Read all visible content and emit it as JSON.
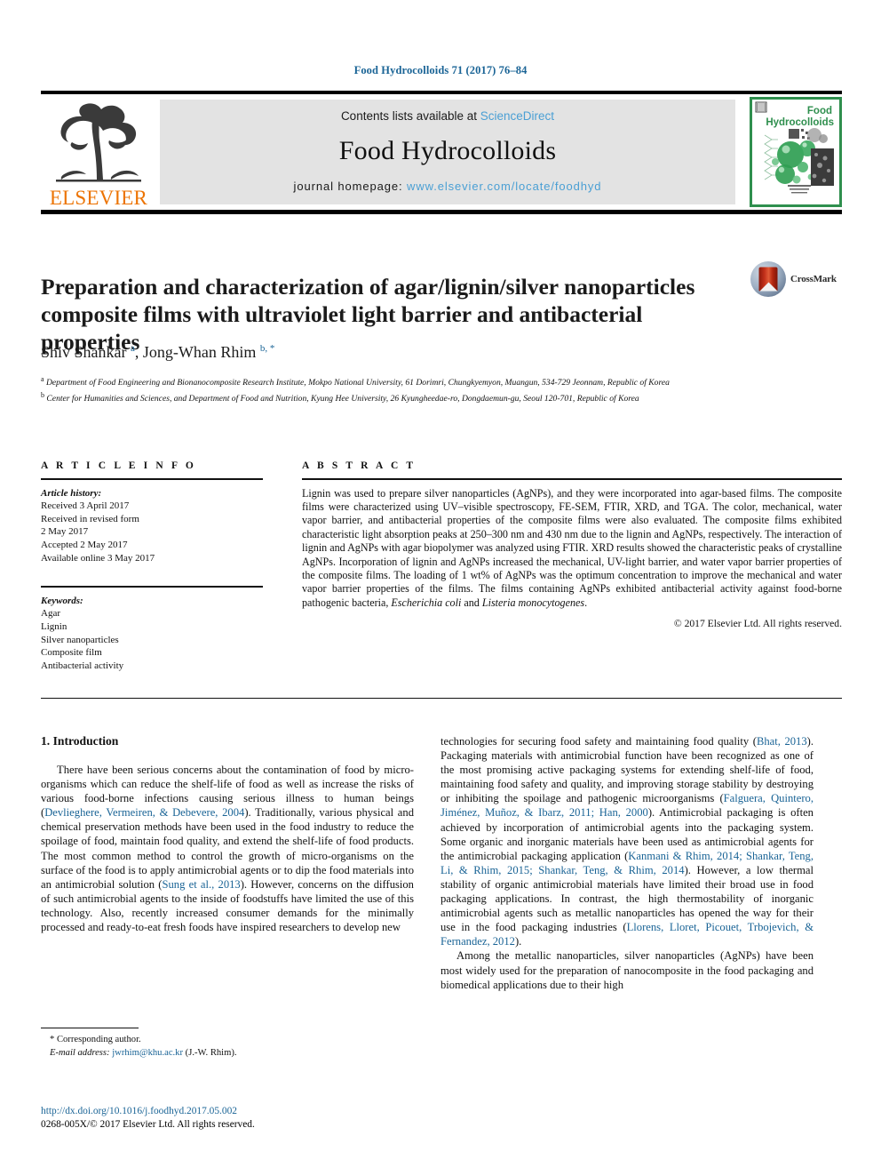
{
  "running_head": "Food Hydrocolloids 71 (2017) 76–84",
  "masthead": {
    "publisher_logo_label": "ELSEVIER",
    "contents_prefix": "Contents lists available at ",
    "contents_link": "ScienceDirect",
    "journal_title": "Food Hydrocolloids",
    "homepage_prefix": "journal homepage: ",
    "homepage_url": "www.elsevier.com/locate/foodhyd",
    "cover_line1": "Food",
    "cover_line2": "Hydrocolloids"
  },
  "article": {
    "title": "Preparation and characterization of agar/lignin/silver nanoparticles composite films with ultraviolet light barrier and antibacterial properties",
    "crossmark_label": "CrossMark",
    "authors_html": "Shiv Shankar <sup>a</sup>, Jong-Whan Rhim <sup>b, *</sup>",
    "affiliation_a": "Department of Food Engineering and Bionanocomposite Research Institute, Mokpo National University, 61 Dorimri, Chungkyemyon, Muangun, 534-729 Jeonnam, Republic of Korea",
    "affiliation_b": "Center for Humanities and Sciences, and Department of Food and Nutrition, Kyung Hee University, 26 Kyungheedae-ro, Dongdaemun-gu, Seoul 120-701, Republic of Korea"
  },
  "article_info": {
    "heading": "A R T I C L E   I N F O",
    "history_label": "Article history:",
    "history": [
      "Received 3 April 2017",
      "Received in revised form",
      "2 May 2017",
      "Accepted 2 May 2017",
      "Available online 3 May 2017"
    ],
    "keywords_label": "Keywords:",
    "keywords": [
      "Agar",
      "Lignin",
      "Silver nanoparticles",
      "Composite film",
      "Antibacterial activity"
    ]
  },
  "abstract": {
    "heading": "A B S T R A C T",
    "text_part1": "Lignin was used to prepare silver nanoparticles (AgNPs), and they were incorporated into agar-based films. The composite films were characterized using UV–visible spectroscopy, FE-SEM, FTIR, XRD, and TGA. The color, mechanical, water vapor barrier, and antibacterial properties of the composite films were also evaluated. The composite films exhibited characteristic light absorption peaks at 250–300 nm and 430 nm due to the lignin and AgNPs, respectively. The interaction of lignin and AgNPs with agar biopolymer was analyzed using FTIR. XRD results showed the characteristic peaks of crystalline AgNPs. Incorporation of lignin and AgNPs increased the mechanical, UV-light barrier, and water vapor barrier properties of the composite films. The loading of 1 wt% of AgNPs was the optimum concentration to improve the mechanical and water vapor barrier properties of the films. The films containing AgNPs exhibited antibacterial activity against food-borne pathogenic bacteria, ",
    "italic1": "Escherichia coli",
    "text_mid": " and ",
    "italic2": "Listeria monocytogenes",
    "text_end": ".",
    "copyright": "© 2017 Elsevier Ltd. All rights reserved."
  },
  "body": {
    "section_title": "1. Introduction",
    "left_p1_a": "There have been serious concerns about the contamination of food by micro-organisms which can reduce the shelf-life of food as well as increase the risks of various food-borne infections causing serious illness to human beings (",
    "left_p1_ref1": "Devlieghere, Vermeiren, & Debevere, 2004",
    "left_p1_b": "). Traditionally, various physical and chemical preservation methods have been used in the food industry to reduce the spoilage of food, maintain food quality, and extend the shelf-life of food products. The most common method to control the growth of micro-organisms on the surface of the food is to apply antimicrobial agents or to dip the food materials into an antimicrobial solution (",
    "left_p1_ref2": "Sung et al., 2013",
    "left_p1_c": "). However, concerns on the diffusion of such antimicrobial agents to the inside of foodstuffs have limited the use of this technology. Also, recently increased consumer demands for the minimally processed and ready-to-eat fresh foods have inspired researchers to develop new",
    "right_p1_a": "technologies for securing food safety and maintaining food quality (",
    "right_p1_ref1": "Bhat, 2013",
    "right_p1_b": "). Packaging materials with antimicrobial function have been recognized as one of the most promising active packaging systems for extending shelf-life of food, maintaining food safety and quality, and improving storage stability by destroying or inhibiting the spoilage and pathogenic microorganisms (",
    "right_p1_ref2": "Falguera, Quintero, Jiménez, Muñoz, & Ibarz, 2011; Han, 2000",
    "right_p1_c": "). Antimicrobial packaging is often achieved by incorporation of antimicrobial agents into the packaging system. Some organic and inorganic materials have been used as antimicrobial agents for the antimicrobial packaging application (",
    "right_p1_ref3": "Kanmani & Rhim, 2014; Shankar, Teng, Li, & Rhim, 2015; Shankar, Teng, & Rhim, 2014",
    "right_p1_d": "). However, a low thermal stability of organic antimicrobial materials have limited their broad use in food packaging applications. In contrast, the high thermostability of inorganic antimicrobial agents such as metallic nanoparticles has opened the way for their use in the food packaging industries (",
    "right_p1_ref4": "Llorens, Lloret, Picouet, Trbojevich, & Fernandez, 2012",
    "right_p1_e": ").",
    "right_p2": "Among the metallic nanoparticles, silver nanoparticles (AgNPs) have been most widely used for the preparation of nanocomposite in the food packaging and biomedical applications due to their high"
  },
  "footnote": {
    "corresponding": "* Corresponding author.",
    "email_label": "E-mail address: ",
    "email": "jwrhim@khu.ac.kr",
    "email_suffix": " (J.-W. Rhim)."
  },
  "doi": {
    "url": "http://dx.doi.org/10.1016/j.foodhyd.2017.05.002",
    "issn_line": "0268-005X/© 2017 Elsevier Ltd. All rights reserved."
  },
  "colors": {
    "link_blue": "#1a6496",
    "banner_link_blue": "#4a9fd4",
    "elsevier_orange": "#ec7404",
    "cover_green": "#2f8f4e"
  }
}
